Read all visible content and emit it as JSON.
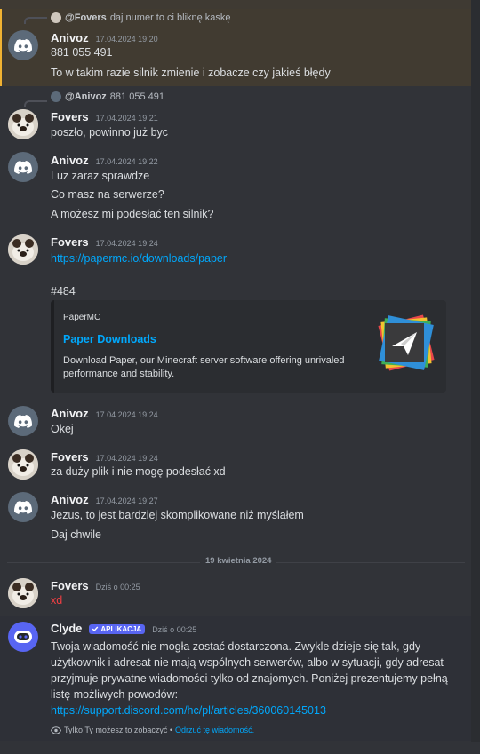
{
  "messages": {
    "m1": {
      "reply": {
        "author": "@Fovers",
        "text": "daj numer to ci bliknę kaskę"
      },
      "author": "Anivoz",
      "time": "17.04.2024 19:20",
      "lines": [
        "881 055 491",
        "To w takim razie silnik zmienie i zobacze czy jakieś błędy"
      ]
    },
    "m2": {
      "reply": {
        "author": "@Anivoz",
        "text": "881 055 491"
      },
      "author": "Fovers",
      "time": "17.04.2024 19:21",
      "lines": [
        "poszło, powinno już byc"
      ]
    },
    "m3": {
      "author": "Anivoz",
      "time": "17.04.2024 19:22",
      "lines": [
        "Luz zaraz sprawdze",
        "Co masz na serwerze?",
        "A możesz mi podesłać ten silnik?"
      ]
    },
    "m4": {
      "author": "Fovers",
      "time": "17.04.2024 19:24",
      "link": "https://papermc.io/downloads/paper",
      "extra": "#484",
      "embed": {
        "provider": "PaperMC",
        "title": "Paper Downloads",
        "description": "Download Paper, our Minecraft server software offering unrivaled performance and stability."
      }
    },
    "m5": {
      "author": "Anivoz",
      "time": "17.04.2024 19:24",
      "lines": [
        "Okej"
      ]
    },
    "m6": {
      "author": "Fovers",
      "time": "17.04.2024 19:24",
      "lines": [
        "za duży plik i nie mogę podesłać xd"
      ]
    },
    "m7": {
      "author": "Anivoz",
      "time": "17.04.2024 19:27",
      "lines": [
        "Jezus, to jest bardziej skomplikowane niż myślałem",
        "Daj chwile"
      ]
    },
    "m8": {
      "author": "Fovers",
      "time": "Dziś o 00:25",
      "lines": [
        "xd"
      ]
    },
    "m9": {
      "author": "Clyde",
      "badge": "APLIKACJA",
      "time": "Dziś o 00:25",
      "text": "Twoja wiadomość nie mogła zostać dostarczona. Zwykle dzieje się tak, gdy użytkownik i adresat nie mają wspólnych serwerów, albo w sytuacji, gdy adresat przyjmuje prywatne wiadomości tylko od znajomych. Poniżej prezentujemy pełną listę możliwych powodów:",
      "link": "https://support.discord.com/hc/pl/articles/360060145013",
      "only_you": "Tylko Ty możesz to zobaczyć •",
      "dismiss": "Odrzuć tę wiadomość."
    }
  },
  "date_divider": "19 kwietnia 2024",
  "colors": {
    "background": "#313338",
    "link": "#00a8fc",
    "mention_highlight": "#413b31",
    "accent": "#5865f2",
    "error_text": "#f23f43"
  },
  "icons": {
    "discord_avatar": "discord-logo-icon",
    "clyde_avatar": "clyde-bot-icon",
    "eye": "eye-icon",
    "verified": "check-icon",
    "embed_thumbnail": "paper-plane-icon"
  }
}
